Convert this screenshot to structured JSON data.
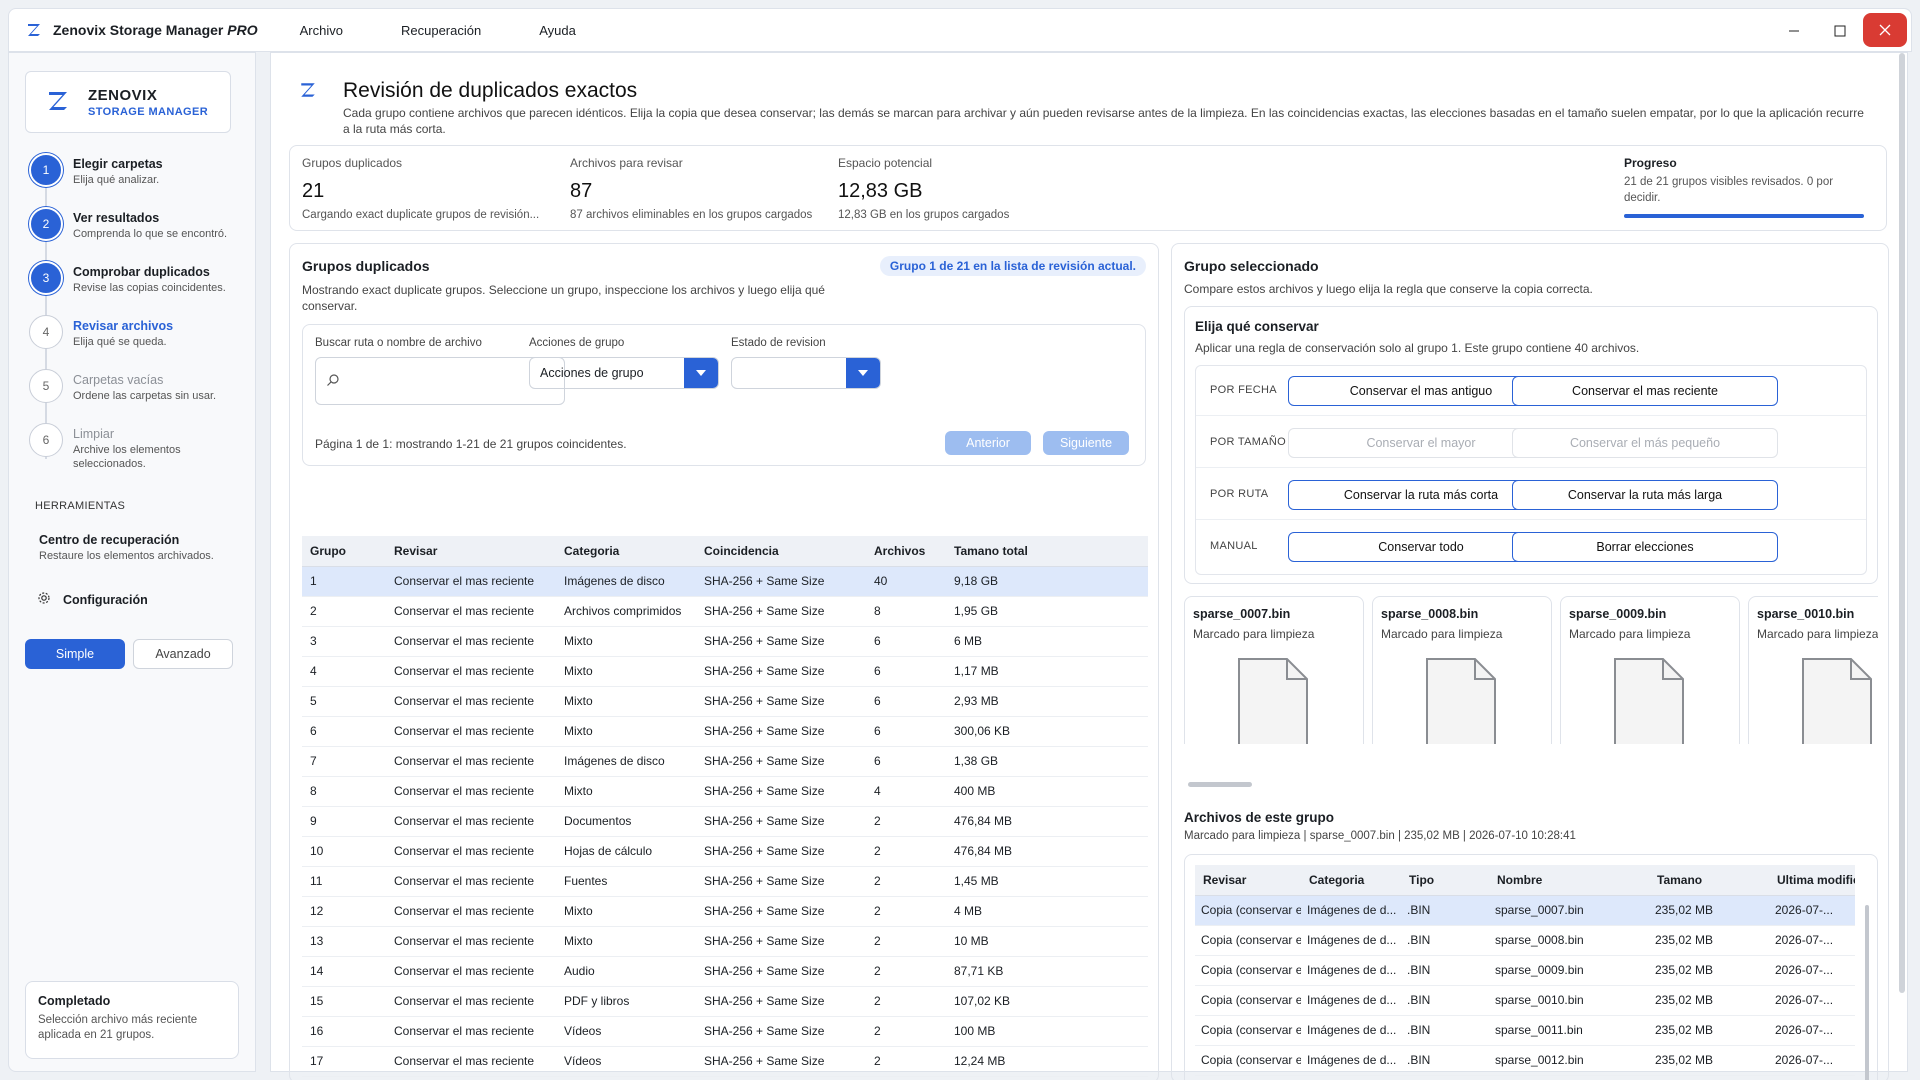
{
  "app": {
    "title": "Zenovix Storage Manager",
    "title_suffix": "PRO",
    "menu": [
      "Archivo",
      "Recuperación",
      "Ayuda"
    ],
    "accent": "#2a62d6"
  },
  "sidebar": {
    "brand_name": "ZENOVIX",
    "brand_sub": "STORAGE MANAGER",
    "steps": [
      {
        "num": "1",
        "title": "Elegir carpetas",
        "sub": "Elija qué analizar.",
        "state": "done"
      },
      {
        "num": "2",
        "title": "Ver resultados",
        "sub": "Comprenda lo que se encontró.",
        "state": "done"
      },
      {
        "num": "3",
        "title": "Comprobar duplicados",
        "sub": "Revise las copias coincidentes.",
        "state": "done"
      },
      {
        "num": "4",
        "title": "Revisar archivos",
        "sub": "Elija qué se queda.",
        "state": "active"
      },
      {
        "num": "5",
        "title": "Carpetas vacías",
        "sub": "Ordene las carpetas sin usar.",
        "state": "dim"
      },
      {
        "num": "6",
        "title": "Limpiar",
        "sub": "Archive los elementos seleccionados.",
        "state": "dim"
      }
    ],
    "tools_heading": "HERRAMIENTAS",
    "recovery_title": "Centro de recuperación",
    "recovery_sub": "Restaure los elementos archivados.",
    "config_label": "Configuración",
    "mode_simple": "Simple",
    "mode_advanced": "Avanzado",
    "done_title": "Completado",
    "done_text": "Selección archivo más reciente aplicada en 21 grupos."
  },
  "header": {
    "title": "Revisión de duplicados exactos",
    "description": "Cada grupo contiene archivos que parecen idénticos. Elija la copia que desea conservar; las demás se marcan para archivar y aún pueden revisarse antes de la limpieza. En las coincidencias exactas, las elecciones basadas en el tamaño suelen empatar, por lo que la aplicación recurre a la ruta más corta."
  },
  "stats": {
    "groups_label": "Grupos duplicados",
    "groups_value": "21",
    "groups_sub": "Cargando exact duplicate grupos de revisión...",
    "files_label": "Archivos para revisar",
    "files_value": "87",
    "files_sub": "87 archivos eliminables en los grupos cargados",
    "space_label": "Espacio potencial",
    "space_value": "12,83 GB",
    "space_sub": "12,83 GB en los grupos cargados",
    "progress_label": "Progreso",
    "progress_text": "21 de 21 grupos visibles revisados. 0 por decidir.",
    "progress_fraction": 1.0
  },
  "groups": {
    "title": "Grupos duplicados",
    "badge": "Grupo 1 de 21 en la lista de revisión actual.",
    "description": "Mostrando exact duplicate grupos. Seleccione un grupo, inspeccione los archivos y luego elija qué conservar.",
    "search_label": "Buscar ruta o nombre de archivo",
    "search_placeholder": "",
    "actions_label": "Acciones de grupo",
    "actions_value": "Acciones de grupo",
    "status_label": "Estado de revision",
    "status_value": "",
    "page_text": "Página 1 de 1: mostrando 1-21 de 21 grupos coincidentes.",
    "prev_label": "Anterior",
    "next_label": "Siguiente",
    "columns": [
      "Grupo",
      "Revisar",
      "Categoria",
      "Coincidencia",
      "Archivos",
      "Tamano total"
    ],
    "rows": [
      [
        "1",
        "Conservar el mas reciente",
        "Imágenes de disco",
        "SHA-256 + Same Size",
        "40",
        "9,18 GB"
      ],
      [
        "2",
        "Conservar el mas reciente",
        "Archivos comprimidos",
        "SHA-256 + Same Size",
        "8",
        "1,95 GB"
      ],
      [
        "3",
        "Conservar el mas reciente",
        "Mixto",
        "SHA-256 + Same Size",
        "6",
        "6 MB"
      ],
      [
        "4",
        "Conservar el mas reciente",
        "Mixto",
        "SHA-256 + Same Size",
        "6",
        "1,17 MB"
      ],
      [
        "5",
        "Conservar el mas reciente",
        "Mixto",
        "SHA-256 + Same Size",
        "6",
        "2,93 MB"
      ],
      [
        "6",
        "Conservar el mas reciente",
        "Mixto",
        "SHA-256 + Same Size",
        "6",
        "300,06 KB"
      ],
      [
        "7",
        "Conservar el mas reciente",
        "Imágenes de disco",
        "SHA-256 + Same Size",
        "6",
        "1,38 GB"
      ],
      [
        "8",
        "Conservar el mas reciente",
        "Mixto",
        "SHA-256 + Same Size",
        "4",
        "400 MB"
      ],
      [
        "9",
        "Conservar el mas reciente",
        "Documentos",
        "SHA-256 + Same Size",
        "2",
        "476,84 MB"
      ],
      [
        "10",
        "Conservar el mas reciente",
        "Hojas de cálculo",
        "SHA-256 + Same Size",
        "2",
        "476,84 MB"
      ],
      [
        "11",
        "Conservar el mas reciente",
        "Fuentes",
        "SHA-256 + Same Size",
        "2",
        "1,45 MB"
      ],
      [
        "12",
        "Conservar el mas reciente",
        "Mixto",
        "SHA-256 + Same Size",
        "2",
        "4 MB"
      ],
      [
        "13",
        "Conservar el mas reciente",
        "Mixto",
        "SHA-256 + Same Size",
        "2",
        "10 MB"
      ],
      [
        "14",
        "Conservar el mas reciente",
        "Audio",
        "SHA-256 + Same Size",
        "2",
        "87,71 KB"
      ],
      [
        "15",
        "Conservar el mas reciente",
        "PDF y libros",
        "SHA-256 + Same Size",
        "2",
        "107,02 KB"
      ],
      [
        "16",
        "Conservar el mas reciente",
        "Vídeos",
        "SHA-256 + Same Size",
        "2",
        "100 MB"
      ],
      [
        "17",
        "Conservar el mas reciente",
        "Vídeos",
        "SHA-256 + Same Size",
        "2",
        "12,24 MB"
      ]
    ]
  },
  "selected": {
    "title": "Grupo seleccionado",
    "description": "Compare estos archivos y luego elija la regla que conserve la copia correcta.",
    "keep_title": "Elija qué conservar",
    "keep_desc": "Aplicar una regla de conservación solo al grupo 1. Este grupo contiene 40 archivos.",
    "rules": [
      {
        "label": "POR FECHA",
        "a": "Conservar el mas antiguo",
        "b": "Conservar el mas reciente",
        "enabled": true
      },
      {
        "label": "POR TAMAÑO",
        "a": "Conservar el mayor",
        "b": "Conservar el más pequeño",
        "enabled": false
      },
      {
        "label": "POR RUTA",
        "a": "Conservar la ruta más corta",
        "b": "Conservar la ruta más larga",
        "enabled": true
      },
      {
        "label": "MANUAL",
        "a": "Conservar todo",
        "b": "Borrar elecciones",
        "enabled": true
      }
    ],
    "cards": [
      {
        "name": "sparse_0007.bin",
        "status": "Marcado para limpieza"
      },
      {
        "name": "sparse_0008.bin",
        "status": "Marcado para limpieza"
      },
      {
        "name": "sparse_0009.bin",
        "status": "Marcado para limpieza"
      },
      {
        "name": "sparse_0010.bin",
        "status": "Marcado para limpieza"
      }
    ],
    "files_title": "Archivos de este grupo",
    "files_meta": "Marcado para limpieza  |  sparse_0007.bin  |  235,02 MB  |  2026-07-10 10:28:41",
    "file_columns": [
      "Revisar",
      "Categoria",
      "Tipo",
      "Nombre",
      "Tamano",
      "Ultima modificación"
    ],
    "file_rows": [
      [
        "Copia (conservar el...",
        "Imágenes de d...",
        ".BIN",
        "sparse_0007.bin",
        "235,02 MB",
        "2026-07-..."
      ],
      [
        "Copia (conservar el...",
        "Imágenes de d...",
        ".BIN",
        "sparse_0008.bin",
        "235,02 MB",
        "2026-07-..."
      ],
      [
        "Copia (conservar el...",
        "Imágenes de d...",
        ".BIN",
        "sparse_0009.bin",
        "235,02 MB",
        "2026-07-..."
      ],
      [
        "Copia (conservar el...",
        "Imágenes de d...",
        ".BIN",
        "sparse_0010.bin",
        "235,02 MB",
        "2026-07-..."
      ],
      [
        "Copia (conservar el...",
        "Imágenes de d...",
        ".BIN",
        "sparse_0011.bin",
        "235,02 MB",
        "2026-07-..."
      ],
      [
        "Copia (conservar el...",
        "Imágenes de d...",
        ".BIN",
        "sparse_0012.bin",
        "235,02 MB",
        "2026-07-..."
      ]
    ]
  }
}
